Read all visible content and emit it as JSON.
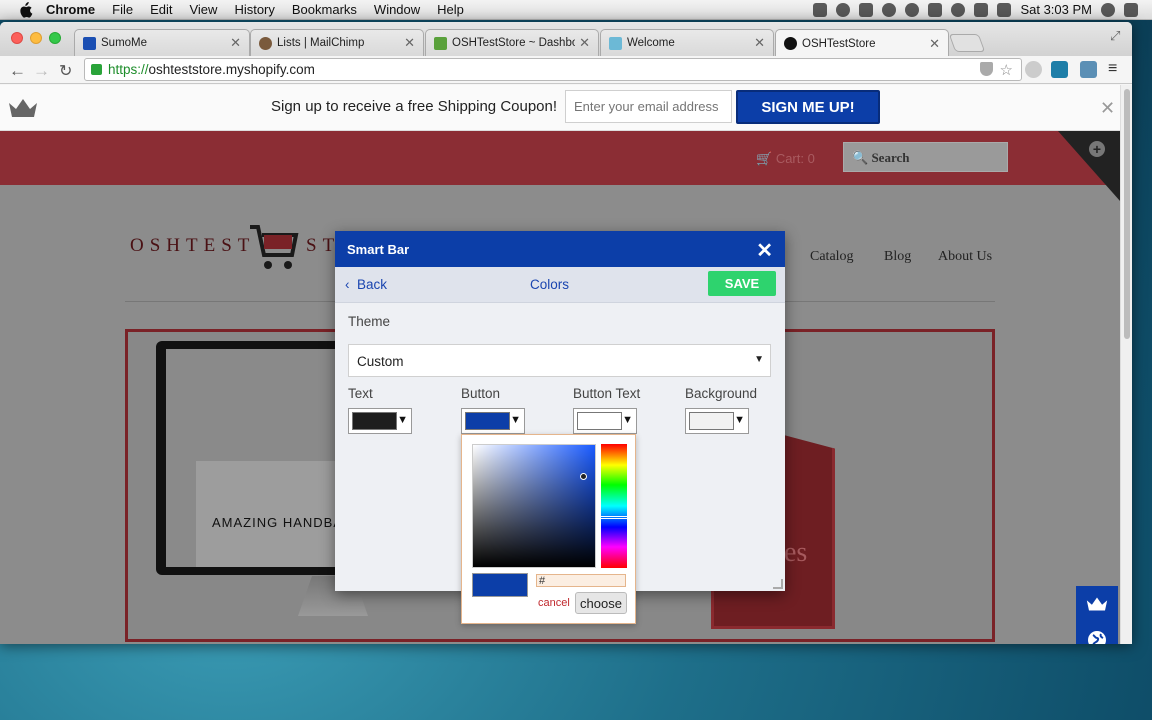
{
  "menubar": {
    "app": "Chrome",
    "items": [
      "File",
      "Edit",
      "View",
      "History",
      "Bookmarks",
      "Window",
      "Help"
    ],
    "clock": "Sat 3:03 PM"
  },
  "tabs": [
    {
      "title": "SumoMe",
      "color": "#1b4fb3"
    },
    {
      "title": "Lists | MailChimp",
      "color": "#7a5a3c"
    },
    {
      "title": "OSHTestStore ~ Dashboard",
      "color": "#5aa13b"
    },
    {
      "title": "Welcome",
      "color": "#6cb9d6"
    },
    {
      "title": "OSHTestStore",
      "color": "#111111"
    }
  ],
  "url": {
    "scheme": "https://",
    "host": "oshteststore.myshopify.com"
  },
  "smartbar": {
    "text": "Sign up to receive a free Shipping Coupon!",
    "placeholder": "Enter your email address",
    "button": "SIGN ME UP!"
  },
  "store": {
    "cart": "Cart: 0",
    "search": "Search",
    "logo_left": "OSHTEST",
    "logo_right": "ST",
    "nav": [
      "Catalog",
      "Blog",
      "About Us"
    ],
    "hero_text": "AMAZING HANDBA",
    "tag_text": "es"
  },
  "modal": {
    "title": "Smart Bar",
    "back": "Back",
    "section": "Colors",
    "save": "SAVE",
    "theme_label": "Theme",
    "theme_value": "Custom",
    "swatches": [
      {
        "label": "Text",
        "color": "#1e1e1e"
      },
      {
        "label": "Button",
        "color": "#0c3ea8"
      },
      {
        "label": "Button Text",
        "color": "#ffffff"
      },
      {
        "label": "Background",
        "color": "#f2f2f2"
      }
    ]
  },
  "picker": {
    "hex": "#",
    "cancel": "cancel",
    "choose": "choose",
    "current": "#0c3ea8"
  },
  "accent": "#0c3ea8"
}
